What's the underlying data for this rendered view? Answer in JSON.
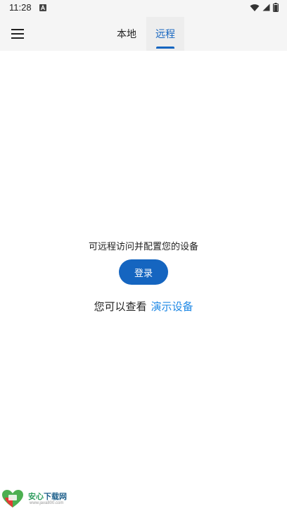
{
  "status_bar": {
    "time": "11:28",
    "icons": [
      "text-a-icon",
      "wifi-icon",
      "signal-icon",
      "battery-icon"
    ]
  },
  "app_bar": {
    "menu_icon": "hamburger-menu-icon",
    "tabs": [
      {
        "label": "本地",
        "selected": false
      },
      {
        "label": "远程",
        "selected": true
      }
    ]
  },
  "main": {
    "description": "可远程访问并配置您的设备",
    "login_label": "登录",
    "demo_prefix": "您可以查看",
    "demo_link": "演示设备"
  },
  "watermark": {
    "title_part1": "安心",
    "title_part2": "下载网",
    "url": "www.java800.com"
  },
  "colors": {
    "accent": "#1565c0",
    "link": "#1e88e5",
    "bar_background": "#f5f5f5"
  }
}
